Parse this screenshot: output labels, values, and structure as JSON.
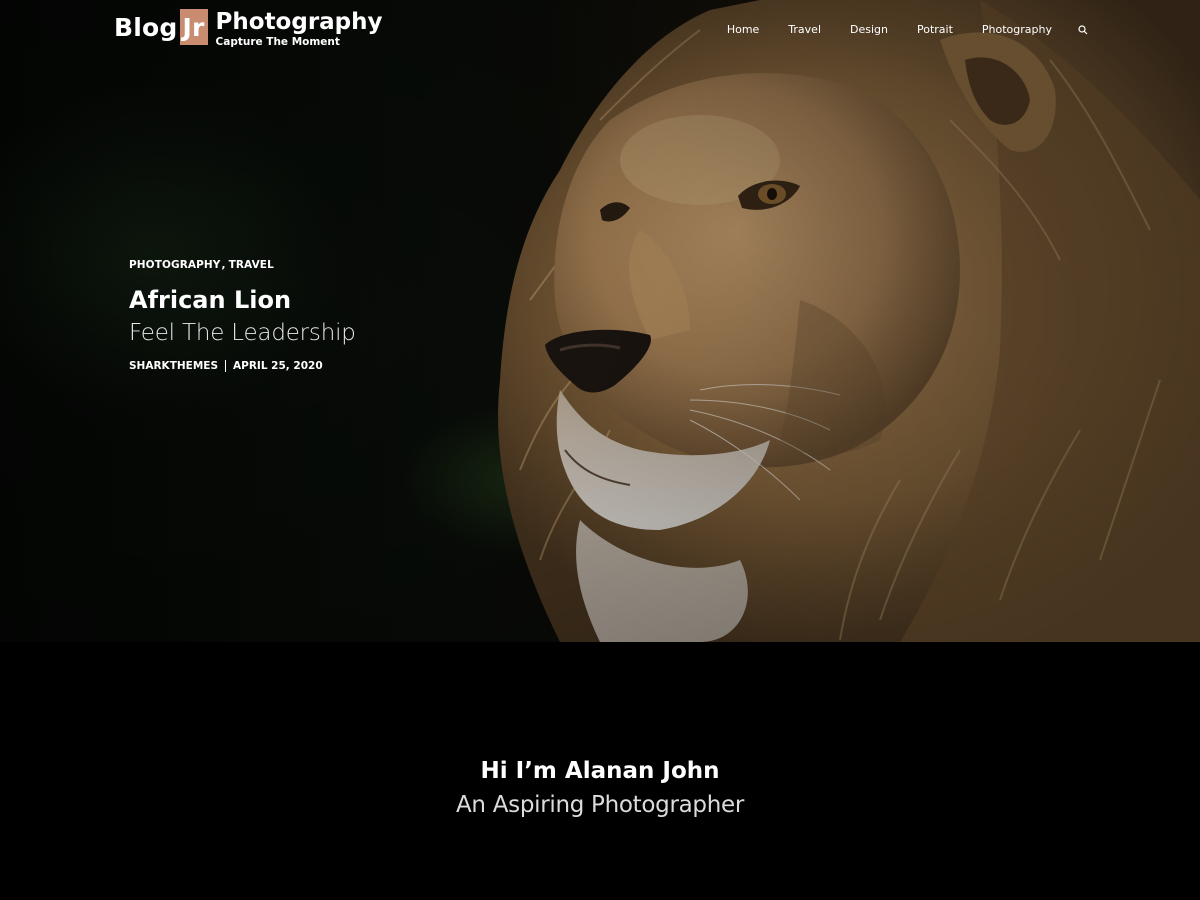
{
  "site": {
    "logo_blog": "Blog",
    "logo_jr": "Jr",
    "title": "Photography",
    "tagline": "Capture The Moment",
    "accent_color": "#c98c70"
  },
  "nav": {
    "items": [
      "Home",
      "Travel",
      "Design",
      "Potrait",
      "Photography"
    ],
    "search_icon": "search-icon"
  },
  "hero": {
    "image": "lion-portrait",
    "categories": [
      "PHOTOGRAPHY",
      "TRAVEL"
    ],
    "category_separator": ",",
    "title": "African Lion",
    "subtitle": "Feel The Leadership",
    "author": "SHARKTHEMES",
    "date": "APRIL 25, 2020"
  },
  "intro": {
    "name": "Hi I’m Alanan John",
    "role": "An Aspiring Photographer"
  }
}
